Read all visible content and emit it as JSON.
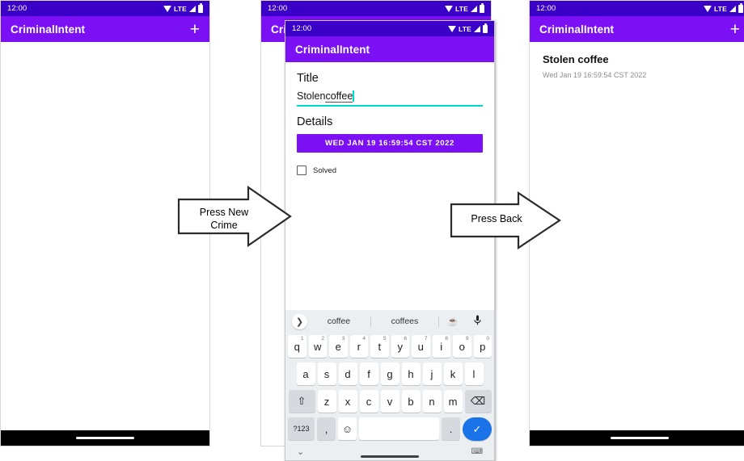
{
  "status_bar": {
    "clock": "12:00",
    "network_label": "LTE",
    "icons": [
      "wifi-icon",
      "lte-label",
      "signal-icon",
      "battery-icon"
    ]
  },
  "app": {
    "name": "CriminalIntent",
    "add_label": "+",
    "accent_purple": "#7c10f5",
    "status_purple": "#3a00c8",
    "accent_teal": "#00d8cc",
    "enter_blue": "#1a73e8"
  },
  "phone1": {
    "appbar_title": "CriminalIntent",
    "add_label": "+",
    "body": ""
  },
  "phone2_back": {
    "appbar_title": "CriminalIntent",
    "add_label": "+"
  },
  "phone2_front": {
    "appbar_title": "CriminalIntent",
    "title_label": "Title",
    "title_value": "Stolen ",
    "title_composing": "coffee",
    "details_label": "Details",
    "date_button": "WED JAN 19 16:59:54 CST 2022",
    "solved_label": "Solved",
    "solved_checked": false
  },
  "phone3": {
    "appbar_title": "CriminalIntent",
    "add_label": "+",
    "crime_title": "Stolen coffee",
    "crime_date": "Wed Jan 19 16:59:54 CST 2022"
  },
  "keyboard": {
    "suggestions": {
      "expand_icon": "chevron-right-icon",
      "word1": "coffee",
      "word2": "coffees",
      "emoji": "☕",
      "mic_icon": "🎙"
    },
    "row1": [
      {
        "k": "q",
        "sup": "1"
      },
      {
        "k": "w",
        "sup": "2"
      },
      {
        "k": "e",
        "sup": "3"
      },
      {
        "k": "r",
        "sup": "4"
      },
      {
        "k": "t",
        "sup": "5"
      },
      {
        "k": "y",
        "sup": "6"
      },
      {
        "k": "u",
        "sup": "7"
      },
      {
        "k": "i",
        "sup": "8"
      },
      {
        "k": "o",
        "sup": "9"
      },
      {
        "k": "p",
        "sup": "0"
      }
    ],
    "row2": [
      "a",
      "s",
      "d",
      "f",
      "g",
      "h",
      "j",
      "k",
      "l"
    ],
    "row3": [
      "z",
      "x",
      "c",
      "v",
      "b",
      "n",
      "m"
    ],
    "shift_label": "⇧",
    "backspace_label": "⌫",
    "symbols_label": "?123",
    "comma_label": ",",
    "emoji_key_label": "☺",
    "space_label": "",
    "period_label": ".",
    "enter_label": "✓",
    "hide_label": "⌄",
    "switch_label": "⌨"
  },
  "arrows": [
    {
      "line1": "Press New",
      "line2": "Crime"
    },
    {
      "line1": "Press Back",
      "line2": ""
    }
  ]
}
